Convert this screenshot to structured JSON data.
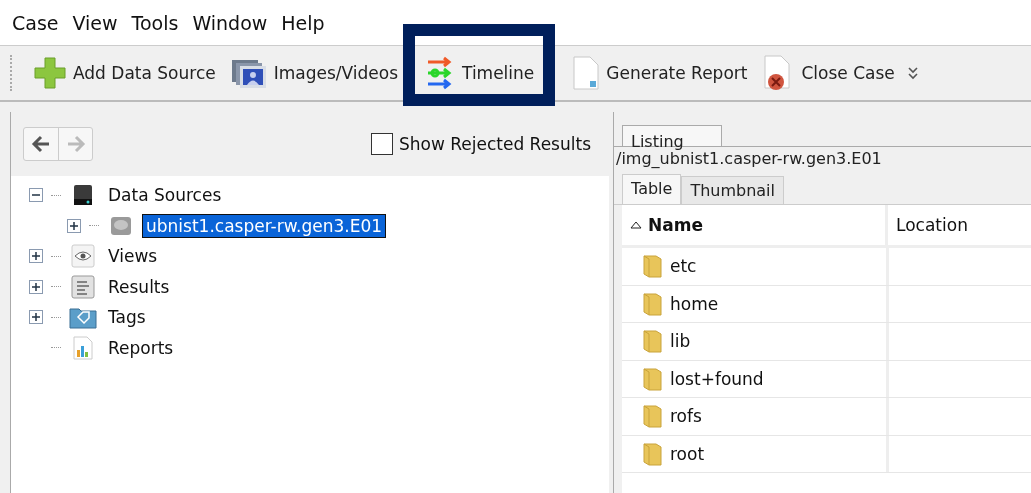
{
  "menu": [
    "Case",
    "View",
    "Tools",
    "Window",
    "Help"
  ],
  "toolbar": [
    {
      "label": "Add Data Source",
      "kind": "plus",
      "highlighted": false
    },
    {
      "label": "Images/Videos",
      "kind": "images",
      "highlighted": false
    },
    {
      "label": "Timeline",
      "kind": "timeline",
      "highlighted": true
    },
    {
      "label": "Generate Report",
      "kind": "report",
      "highlighted": false
    },
    {
      "label": "Close Case",
      "kind": "close",
      "highlighted": false
    }
  ],
  "nav": {
    "back_disabled": false,
    "forward_disabled": true
  },
  "show_rejected": {
    "label": "Show Rejected Results",
    "checked": false
  },
  "tree": [
    {
      "label": "Data Sources",
      "kind": "drive",
      "expanded": true,
      "selected": false,
      "children": [
        {
          "label": "ubnist1.casper-rw.gen3.E01",
          "kind": "disk",
          "expanded": false,
          "selected": true
        }
      ]
    },
    {
      "label": "Views",
      "kind": "eye",
      "expanded": false,
      "selected": false
    },
    {
      "label": "Results",
      "kind": "list",
      "expanded": false,
      "selected": false
    },
    {
      "label": "Tags",
      "kind": "tag",
      "expanded": false,
      "selected": false
    },
    {
      "label": "Reports",
      "kind": "chart",
      "selected": false
    }
  ],
  "listing": {
    "tabs": [
      {
        "label": "Listing",
        "selected": true
      }
    ],
    "path": "/img_ubnist1.casper-rw.gen3.E01",
    "view_tabs": [
      {
        "label": "Table",
        "selected": true
      },
      {
        "label": "Thumbnail",
        "selected": false
      }
    ],
    "columns": [
      "Name",
      "Location"
    ],
    "rows": [
      {
        "name": "etc"
      },
      {
        "name": "home"
      },
      {
        "name": "lib"
      },
      {
        "name": "lost+found"
      },
      {
        "name": "rofs"
      },
      {
        "name": "root"
      }
    ]
  }
}
